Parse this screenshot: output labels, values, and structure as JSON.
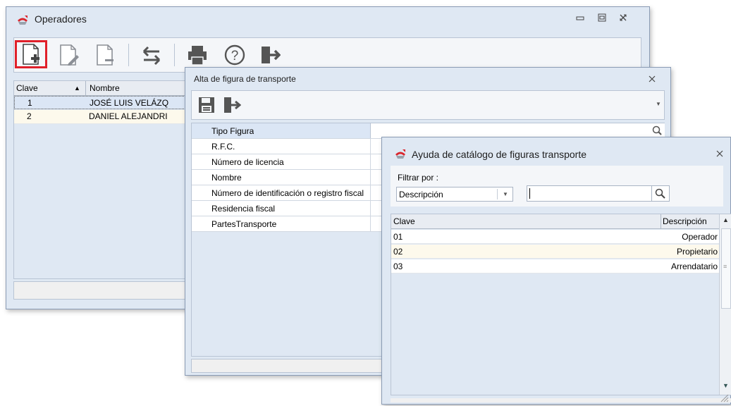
{
  "operadores": {
    "title": "Operadores",
    "columns": [
      "Clave",
      "Nombre"
    ],
    "rows": [
      {
        "clave": "1",
        "nombre": "JOSÉ LUIS VELÁZQ"
      },
      {
        "clave": "2",
        "nombre": "DANIEL ALEJANDRI"
      }
    ],
    "toolbar_icons": [
      "new-document-icon",
      "edit-document-icon",
      "delete-document-icon",
      "swap-arrows-icon",
      "printer-icon",
      "help-icon",
      "exit-icon"
    ]
  },
  "alta": {
    "title": "Alta de figura de transporte",
    "fields": [
      {
        "label": "Tipo Figura",
        "value": ""
      },
      {
        "label": "R.F.C.",
        "value": ""
      },
      {
        "label": "Número de licencia",
        "value": ""
      },
      {
        "label": "Nombre",
        "value": ""
      },
      {
        "label": "Número de identificación o registro fiscal",
        "value": ""
      },
      {
        "label": "Residencia fiscal",
        "value": ""
      },
      {
        "label": "PartesTransporte",
        "value": ""
      }
    ]
  },
  "ayuda": {
    "title": "Ayuda de catálogo de figuras transporte",
    "filter_label": "Filtrar por :",
    "filter_selected": "Descripción",
    "search_value": "",
    "columns": [
      "Clave",
      "Descripción"
    ],
    "rows": [
      {
        "clave": "01",
        "descripcion": "Operador"
      },
      {
        "clave": "02",
        "descripcion": "Propietario"
      },
      {
        "clave": "03",
        "descripcion": "Arrendatario"
      }
    ]
  },
  "colors": {
    "title_bg": "#dfe8f3",
    "selected_row": "#dbe6f5",
    "alt_row": "#fdf9ec",
    "highlight_border": "#e0202a"
  }
}
